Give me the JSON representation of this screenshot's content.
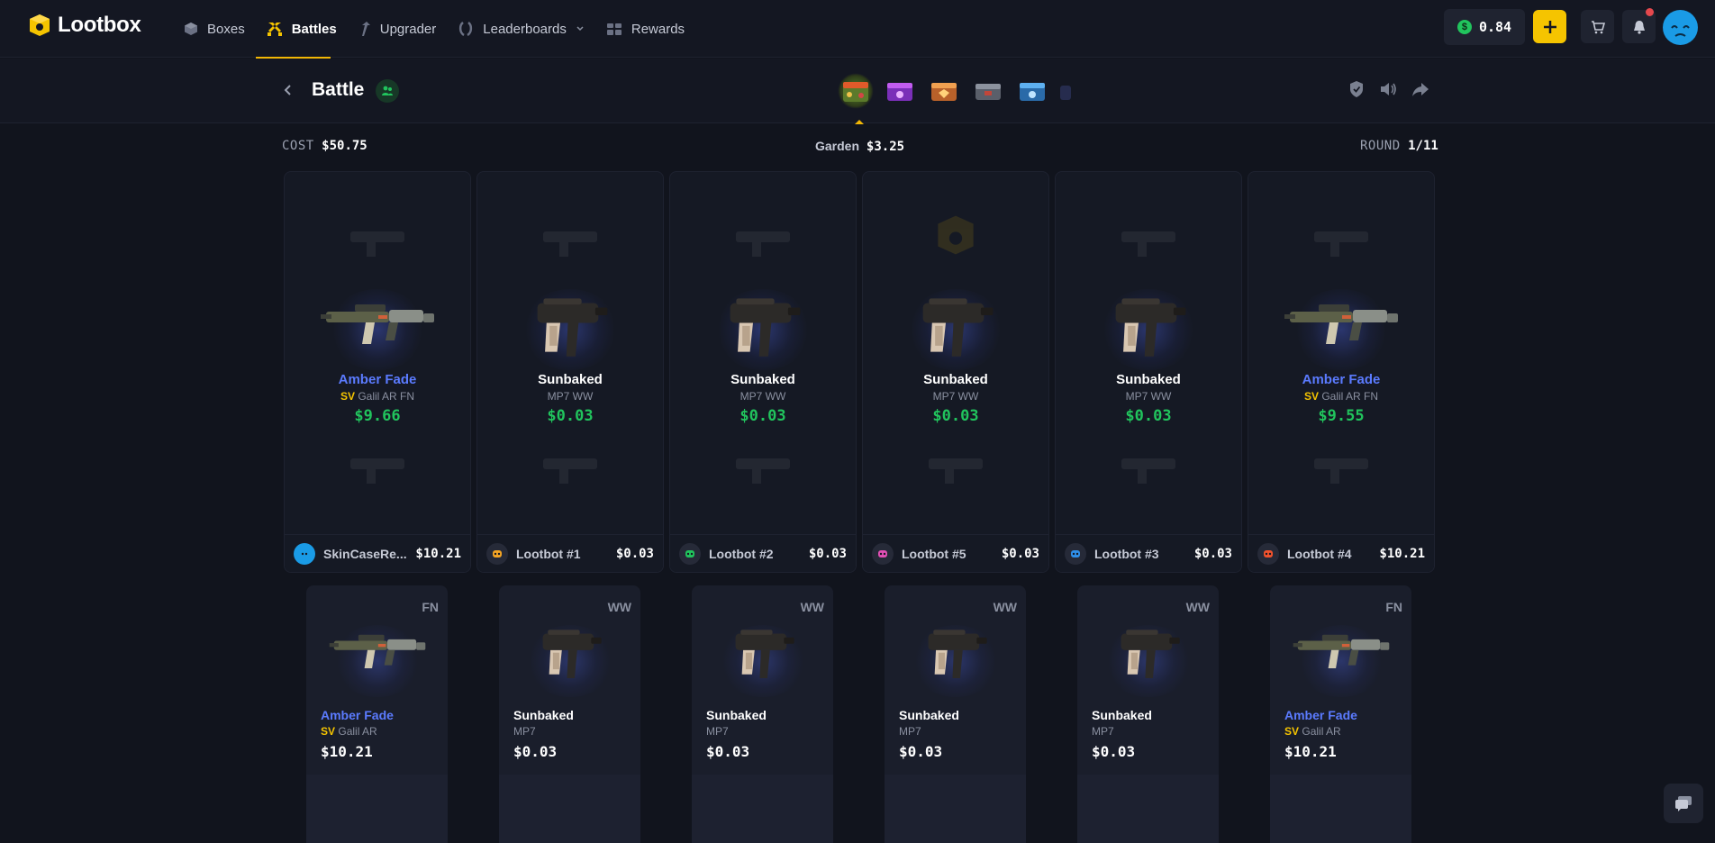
{
  "brand": {
    "name": "Lootbox"
  },
  "nav": [
    {
      "label": "Boxes",
      "icon": "box-icon"
    },
    {
      "label": "Battles",
      "icon": "swords-icon",
      "active": true
    },
    {
      "label": "Upgrader",
      "icon": "upgrade-icon"
    },
    {
      "label": "Leaderboards",
      "icon": "laurel-icon"
    },
    {
      "label": "Rewards",
      "icon": "gift-icon"
    }
  ],
  "balance": {
    "amount": "0.84",
    "currency_symbol": "$"
  },
  "battle": {
    "title": "Battle",
    "cost_label": "COST",
    "cost_value": "$50.75",
    "current_case_name": "Garden",
    "current_case_price": "$3.25",
    "round_label": "ROUND",
    "round_value": "1/11"
  },
  "players": [
    {
      "name": "SkinCaseRe...",
      "total": "$10.21",
      "avatar_color": "#1a9be6",
      "item": {
        "name": "Amber Fade",
        "name_color": "blue",
        "sv": "SV",
        "sub": "Galil AR FN",
        "price": "$9.66",
        "weapon": "rifle"
      }
    },
    {
      "name": "Lootbot #1",
      "total": "$0.03",
      "avatar_color": "#f5a524",
      "item": {
        "name": "Sunbaked",
        "name_color": "white",
        "sv": "",
        "sub": "MP7 WW",
        "price": "$0.03",
        "weapon": "smg"
      }
    },
    {
      "name": "Lootbot #2",
      "total": "$0.03",
      "avatar_color": "#21c45d",
      "item": {
        "name": "Sunbaked",
        "name_color": "white",
        "sv": "",
        "sub": "MP7 WW",
        "price": "$0.03",
        "weapon": "smg"
      }
    },
    {
      "name": "Lootbot #5",
      "total": "$0.03",
      "avatar_color": "#e24fb4",
      "item": {
        "name": "Sunbaked",
        "name_color": "white",
        "sv": "",
        "sub": "MP7 WW",
        "price": "$0.03",
        "weapon": "smg"
      }
    },
    {
      "name": "Lootbot #3",
      "total": "$0.03",
      "avatar_color": "#2f8fe8",
      "item": {
        "name": "Sunbaked",
        "name_color": "white",
        "sv": "",
        "sub": "MP7 WW",
        "price": "$0.03",
        "weapon": "smg"
      }
    },
    {
      "name": "Lootbot #4",
      "total": "$10.21",
      "avatar_color": "#f0522d",
      "item": {
        "name": "Amber Fade",
        "name_color": "blue",
        "sv": "SV",
        "sub": "Galil AR FN",
        "price": "$9.55",
        "weapon": "rifle"
      }
    }
  ],
  "results": [
    {
      "condition": "FN",
      "name": "Amber Fade",
      "name_color": "blue",
      "sv": "SV",
      "sub": "Galil AR",
      "price": "$10.21",
      "weapon": "rifle"
    },
    {
      "condition": "WW",
      "name": "Sunbaked",
      "name_color": "white",
      "sv": "",
      "sub": "MP7",
      "price": "$0.03",
      "weapon": "smg"
    },
    {
      "condition": "WW",
      "name": "Sunbaked",
      "name_color": "white",
      "sv": "",
      "sub": "MP7",
      "price": "$0.03",
      "weapon": "smg"
    },
    {
      "condition": "WW",
      "name": "Sunbaked",
      "name_color": "white",
      "sv": "",
      "sub": "MP7",
      "price": "$0.03",
      "weapon": "smg"
    },
    {
      "condition": "WW",
      "name": "Sunbaked",
      "name_color": "white",
      "sv": "",
      "sub": "MP7",
      "price": "$0.03",
      "weapon": "smg"
    },
    {
      "condition": "FN",
      "name": "Amber Fade",
      "name_color": "blue",
      "sv": "SV",
      "sub": "Galil AR",
      "price": "$10.21",
      "weapon": "rifle"
    }
  ],
  "colors": {
    "accent": "#f5c400",
    "price_green": "#21c45d",
    "item_blue": "#5b7bff",
    "bg": "#11141d"
  }
}
